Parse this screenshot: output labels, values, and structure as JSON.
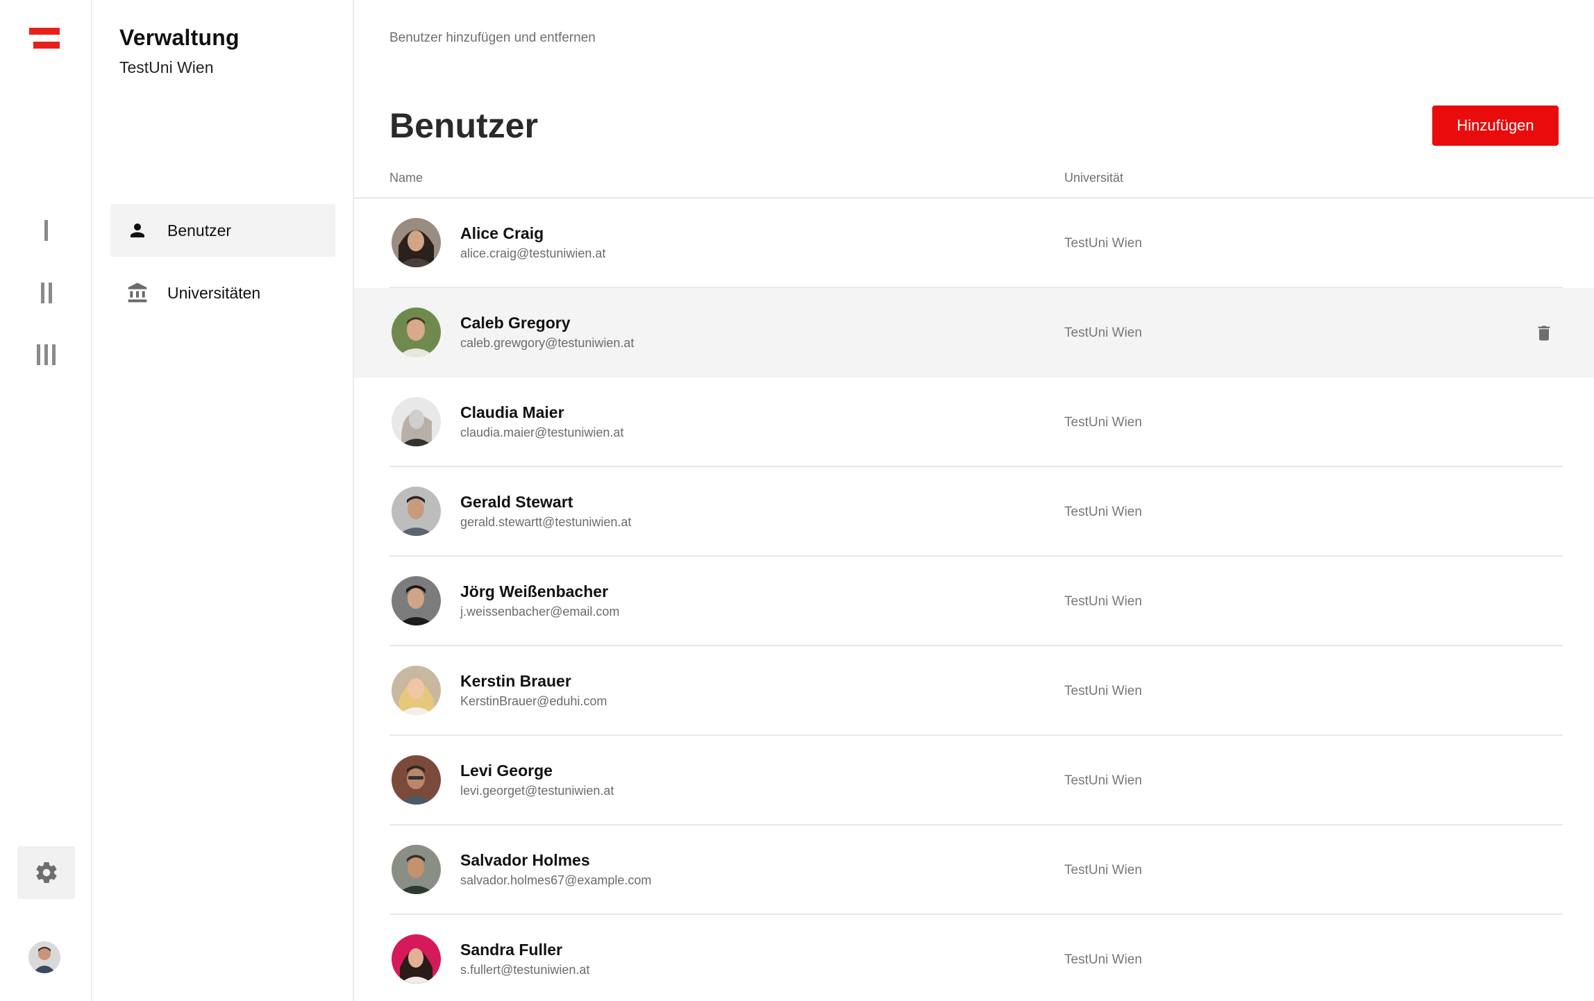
{
  "rail": {
    "numerals": [
      "I",
      "II",
      "III"
    ]
  },
  "subnav": {
    "title": "Verwaltung",
    "subtitle": "TestUni Wien",
    "items": [
      {
        "label": "Benutzer",
        "icon": "person-icon",
        "active": true
      },
      {
        "label": "Universitäten",
        "icon": "university-icon",
        "active": false
      }
    ]
  },
  "main": {
    "breadcrumb": "Benutzer hinzufügen und entfernen",
    "title": "Benutzer",
    "add_button": "Hinzufügen",
    "columns": {
      "name": "Name",
      "university": "Universität"
    },
    "users": [
      {
        "name": "Alice Craig",
        "email": "alice.craig@testuniwien.at",
        "university": "TestUni Wien"
      },
      {
        "name": "Caleb Gregory",
        "email": "caleb.grewgory@testuniwien.at",
        "university": "TestUni Wien"
      },
      {
        "name": "Claudia Maier",
        "email": "claudia.maier@testuniwien.at",
        "university": "TestUni Wien"
      },
      {
        "name": "Gerald Stewart",
        "email": "gerald.stewartt@testuniwien.at",
        "university": "TestUni Wien"
      },
      {
        "name": "Jörg Weißenbacher",
        "email": "j.weissenbacher@email.com",
        "university": "TestUni Wien"
      },
      {
        "name": "Kerstin Brauer",
        "email": "KerstinBrauer@eduhi.com",
        "university": "TestUni Wien"
      },
      {
        "name": "Levi George",
        "email": "levi.georget@testuniwien.at",
        "university": "TestUni Wien"
      },
      {
        "name": "Salvador Holmes",
        "email": "salvador.holmes67@example.com",
        "university": "TestUni Wien"
      },
      {
        "name": "Sandra Fuller",
        "email": "s.fullert@testuniwien.at",
        "university": "TestUni Wien"
      }
    ]
  },
  "colors": {
    "accent": "#ea0c0c",
    "logo": "#e8201c",
    "hover_row": "#f4f4f4"
  }
}
